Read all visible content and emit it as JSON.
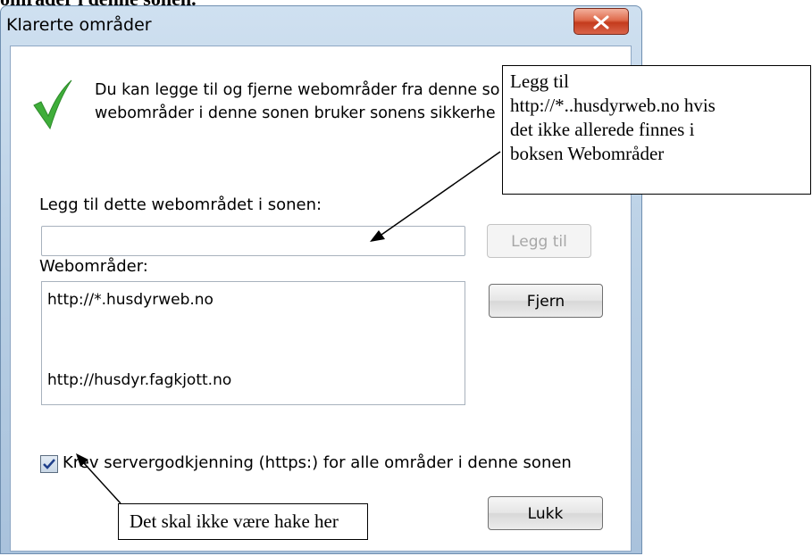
{
  "document": {
    "heading": "områder i denne sonen."
  },
  "dialog": {
    "title": "Klarerte områder",
    "info_lines": [
      "Du kan legge til og fjerne webområder fra denne so",
      "webområder i denne sonen bruker sonens sikkerhe"
    ],
    "add_label": "Legg til dette webområdet i sonen:",
    "add_input_value": "",
    "add_button": "Legg til",
    "sites_label": "Webområder:",
    "sites": [
      "http://*.husdyrweb.no",
      "http://husdyr.fagkjott.no"
    ],
    "remove_button": "Fjern",
    "checkbox_label": "Krev servergodkjenning (https:) for alle områder i denne sonen",
    "checkbox_checked": true,
    "close_button": "Lukk"
  },
  "annotations": {
    "callout_add": [
      "Legg til",
      "http://*..husdyrweb.no hvis",
      "det ikke allerede finnes i",
      "boksen Webområder"
    ],
    "callout_checkbox": "Det skal ikke være hake her"
  },
  "icons": {
    "info": "green-checkmark-icon",
    "close": "close-x-icon",
    "check": "checkmark-icon"
  },
  "colors": {
    "check_green": "#3fae3a",
    "close_red": "#c43b1c",
    "titlebar": "#b6cde3"
  }
}
